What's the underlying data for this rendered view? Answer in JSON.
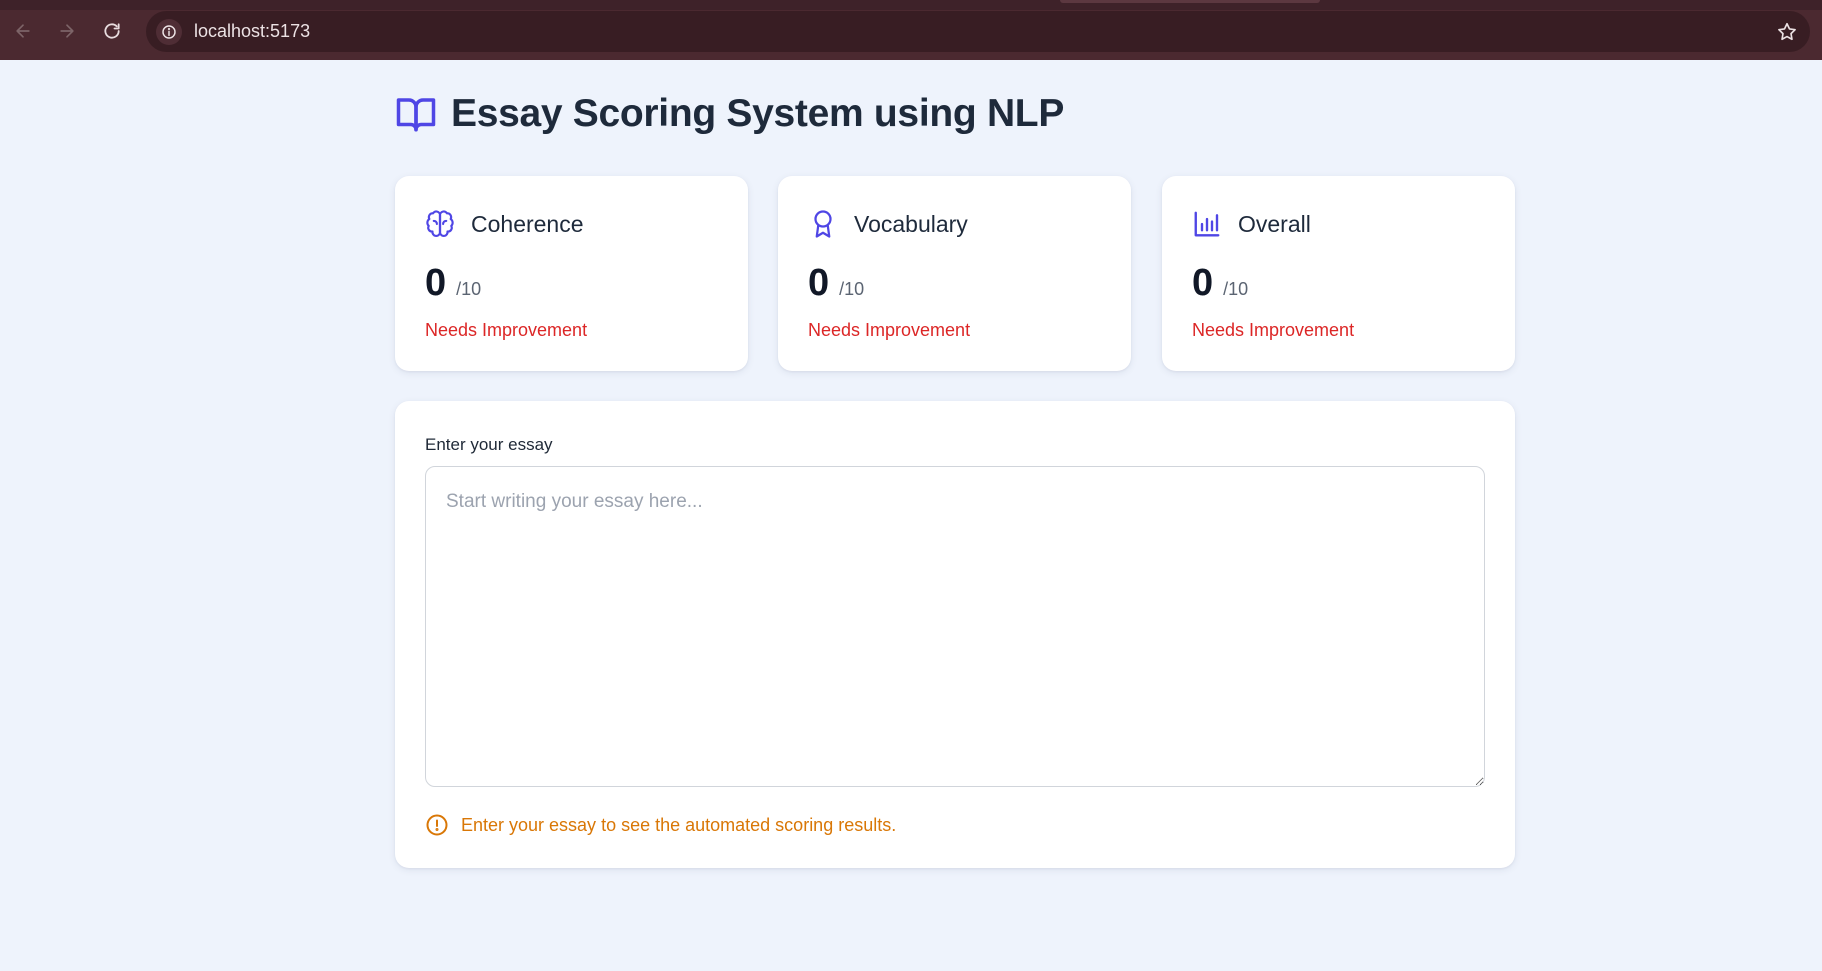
{
  "browser": {
    "url": "localhost:5173"
  },
  "app": {
    "title": "Essay Scoring System using NLP",
    "title_icon": "book-open-icon",
    "accent_color": "#4f46e5"
  },
  "cards": [
    {
      "label": "Coherence",
      "icon": "brain-icon",
      "score": "0",
      "max": "/10",
      "status": "Needs Improvement"
    },
    {
      "label": "Vocabulary",
      "icon": "award-icon",
      "score": "0",
      "max": "/10",
      "status": "Needs Improvement"
    },
    {
      "label": "Overall",
      "icon": "bar-chart-icon",
      "score": "0",
      "max": "/10",
      "status": "Needs Improvement"
    }
  ],
  "essay": {
    "label": "Enter your essay",
    "placeholder": "Start writing your essay here...",
    "value": "",
    "hint": "Enter your essay to see the automated scoring results.",
    "hint_icon": "alert-circle-icon"
  },
  "colors": {
    "status_bad": "#dc2626",
    "hint": "#d97706"
  }
}
